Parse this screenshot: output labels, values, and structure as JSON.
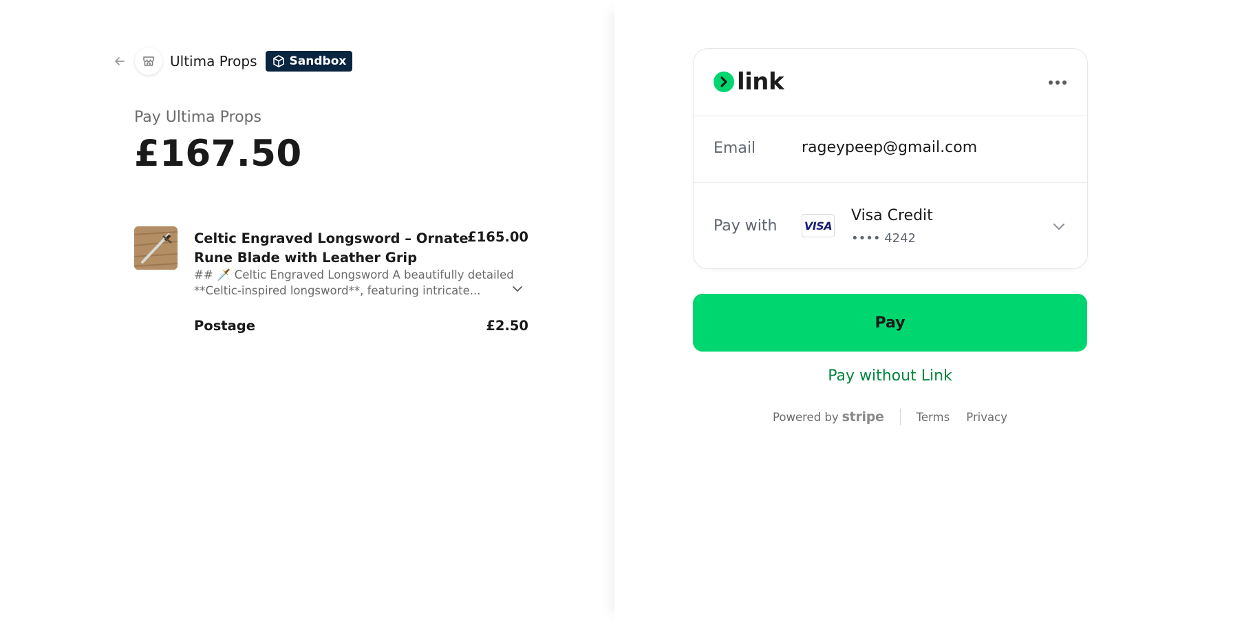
{
  "merchant": {
    "name": "Ultima Props",
    "mode_badge": "Sandbox"
  },
  "summary": {
    "pay_label": "Pay Ultima Props",
    "total": "£167.50"
  },
  "line_items": [
    {
      "name": "Celtic Engraved Longsword – Ornate Rune Blade with Leather Grip",
      "price": "£165.00",
      "description": "## 🗡️ Celtic Engraved Longsword A beautifully detailed **Celtic-inspired longsword**, featuring intricate..."
    }
  ],
  "postage": {
    "label": "Postage",
    "price": "£2.50"
  },
  "link": {
    "logo_text": "link",
    "email_label": "Email",
    "email": "rageypeep@gmail.com",
    "pay_with_label": "Pay with",
    "card_brand": "VISA",
    "card_name": "Visa Credit",
    "card_number": "•••• 4242",
    "accent": "#00d66f"
  },
  "actions": {
    "pay": "Pay",
    "pay_without_link": "Pay without Link"
  },
  "footer": {
    "powered_by": "Powered by",
    "stripe": "stripe",
    "terms": "Terms",
    "privacy": "Privacy"
  }
}
